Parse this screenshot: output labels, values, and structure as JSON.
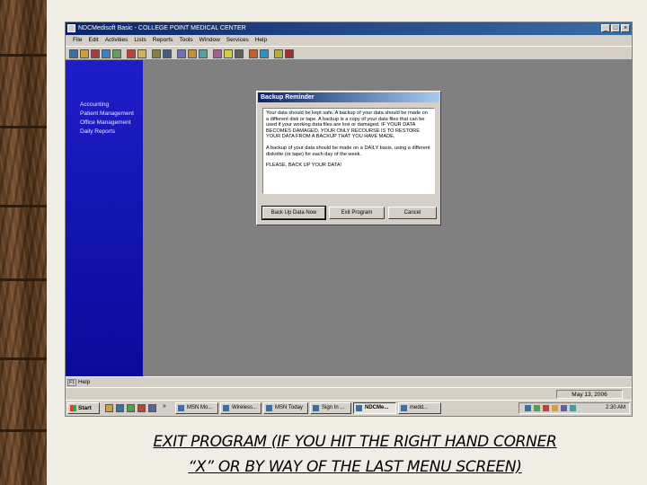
{
  "window": {
    "title": "NDCMedisoft Basic - COLLEGE POINT MEDICAL CENTER",
    "controls": [
      "_",
      "□",
      "×"
    ]
  },
  "menu": [
    "File",
    "Edit",
    "Activities",
    "Lists",
    "Reports",
    "Tools",
    "Window",
    "Services",
    "Help"
  ],
  "sidebar": {
    "items": [
      "Accounting",
      "Patient Management",
      "Office Management",
      "Daily Reports"
    ]
  },
  "dialog": {
    "title": "Backup Reminder",
    "paragraph1": "Your data should be kept safe. A backup of your data should be made on a different disk or tape. A backup is a copy of your data files that can be used if your working data files are lost or damaged. IF YOUR DATA BECOMES DAMAGED, YOUR ONLY RECOURSE IS TO RESTORE YOUR DATA FROM A BACKUP THAT YOU HAVE MADE.",
    "paragraph2": "A backup of your data should be made on a DAILY basis, using a different diskette (or tape) for each day of the week.",
    "paragraph3": "PLEASE, BACK UP YOUR DATA!",
    "buttons": {
      "backup": "Back Up Data Now",
      "exit": "Exit Program",
      "cancel": "Cancel"
    }
  },
  "statusbar": {
    "key": "F1",
    "help": "Help",
    "date": "May 13, 2006"
  },
  "taskbar": {
    "start": "Start",
    "chevron": "»",
    "tasks": [
      "MSN Mo...",
      "Wireless...",
      "MSN Today",
      "Sign In ...",
      "NDCMe...",
      "medd..."
    ],
    "time": "2:30 AM"
  },
  "caption": {
    "line1": "EXIT PROGRAM (IF YOU HIT THE RIGHT HAND CORNER",
    "line2": "“X” OR BY WAY OF THE LAST MENU SCREEN)"
  },
  "colors": {
    "sidebar": "#1414b4",
    "workspace": "#808080",
    "titlebar": "#0a246a",
    "dialog": "#d4d0c8"
  }
}
